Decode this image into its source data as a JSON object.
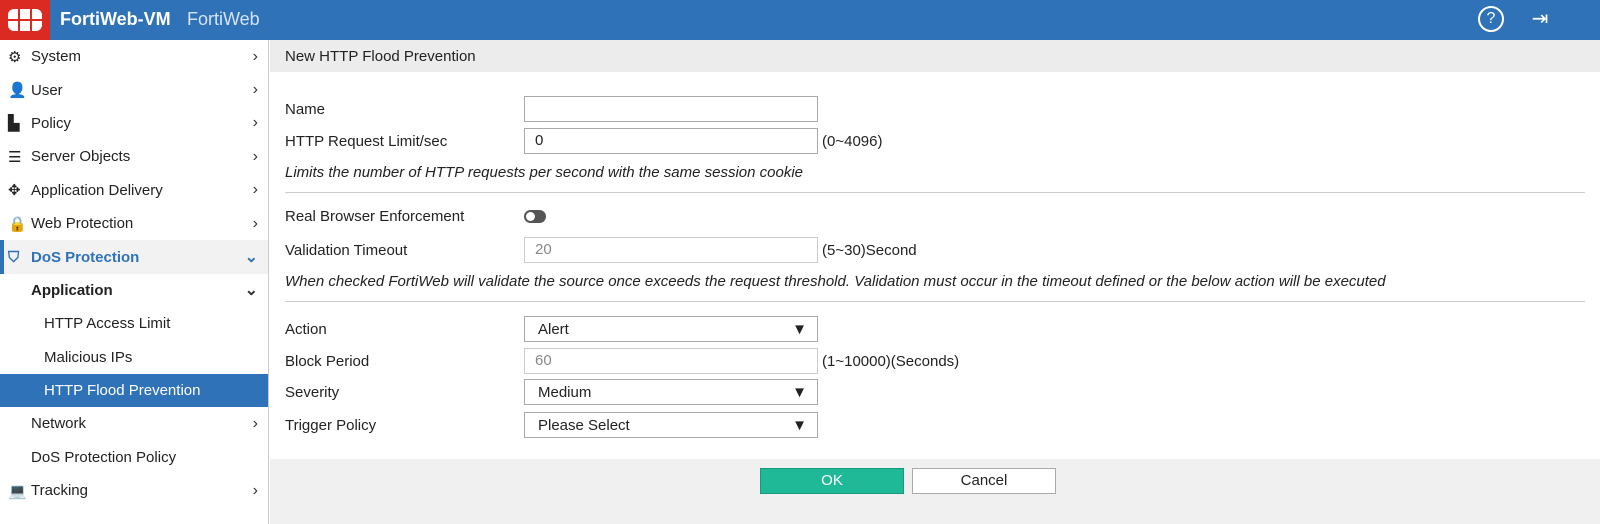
{
  "header": {
    "product": "FortiWeb-VM",
    "brand": "FortiWeb",
    "help_icon": "question-circle-icon",
    "logout_icon": "sign-out-icon"
  },
  "sidebar": {
    "items": [
      {
        "label": "System",
        "icon": "gear-icon"
      },
      {
        "label": "User",
        "icon": "user-icon"
      },
      {
        "label": "Policy",
        "icon": "policy-icon"
      },
      {
        "label": "Server Objects",
        "icon": "server-icon"
      },
      {
        "label": "Application Delivery",
        "icon": "arrows-icon"
      },
      {
        "label": "Web Protection",
        "icon": "lock-icon"
      },
      {
        "label": "DoS Protection",
        "icon": "shield-icon"
      },
      {
        "label": "Application"
      },
      {
        "label": "HTTP Access Limit"
      },
      {
        "label": "Malicious IPs"
      },
      {
        "label": "HTTP Flood Prevention"
      },
      {
        "label": "Network"
      },
      {
        "label": "DoS Protection Policy"
      },
      {
        "label": "Tracking",
        "icon": "laptop-icon"
      }
    ]
  },
  "form": {
    "title": "New HTTP Flood Prevention",
    "name_label": "Name",
    "name_value": "",
    "limit_label": "HTTP Request Limit/sec",
    "limit_value": "0",
    "limit_hint": "(0~4096)",
    "limit_note": "Limits the number of HTTP requests per second with the same session cookie",
    "rbe_label": "Real Browser Enforcement",
    "rbe_enabled": false,
    "timeout_label": "Validation Timeout",
    "timeout_value": "20",
    "timeout_hint": "(5~30)Second",
    "rbe_note": "When checked FortiWeb will validate the source once exceeds the request threshold. Validation must occur in the timeout defined or the below action will be executed",
    "action_label": "Action",
    "action_value": "Alert",
    "block_label": "Block Period",
    "block_value": "60",
    "block_hint": "(1~10000)(Seconds)",
    "severity_label": "Severity",
    "severity_value": "Medium",
    "trigger_label": "Trigger Policy",
    "trigger_value": "Please Select",
    "ok": "OK",
    "cancel": "Cancel"
  }
}
